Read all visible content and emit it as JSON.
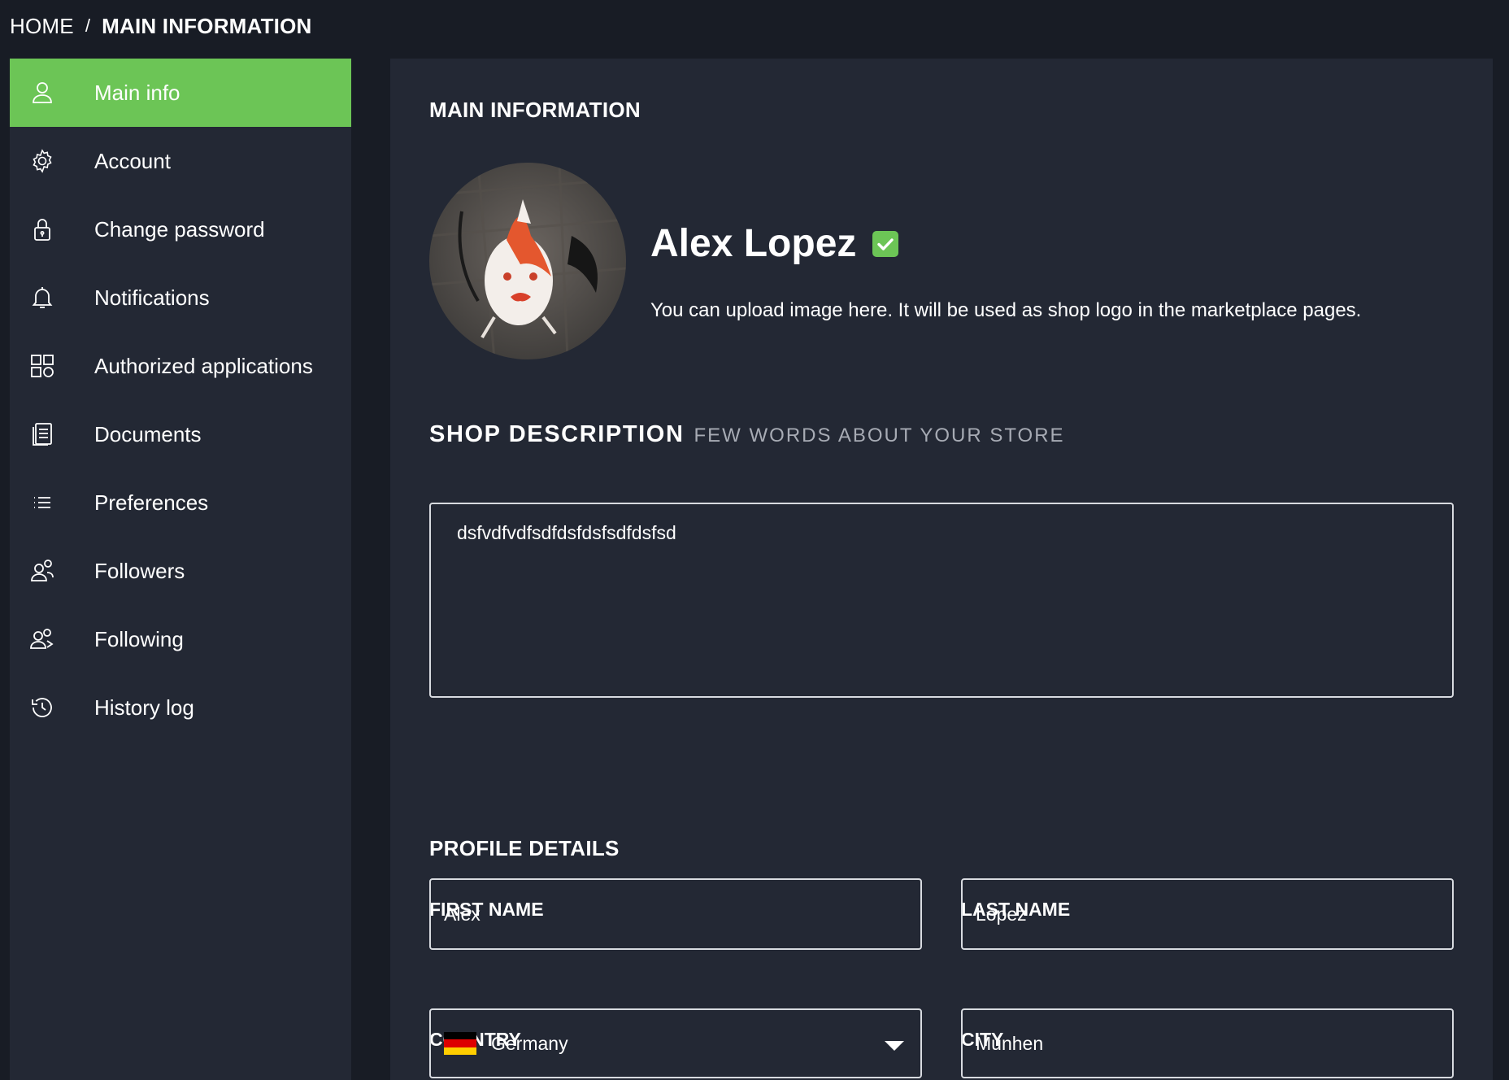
{
  "breadcrumb": {
    "home": "HOME",
    "separator": "/",
    "current": "MAIN INFORMATION"
  },
  "sidebar": {
    "items": [
      {
        "label": "Main info",
        "icon": "user-icon",
        "active": true
      },
      {
        "label": "Account",
        "icon": "gear-icon"
      },
      {
        "label": "Change password",
        "icon": "lock-icon"
      },
      {
        "label": "Notifications",
        "icon": "bell-icon"
      },
      {
        "label": "Authorized applications",
        "icon": "apps-grid-icon"
      },
      {
        "label": "Documents",
        "icon": "documents-icon"
      },
      {
        "label": "Preferences",
        "icon": "list-icon"
      },
      {
        "label": "Followers",
        "icon": "followers-icon"
      },
      {
        "label": "Following",
        "icon": "following-icon"
      },
      {
        "label": "History log",
        "icon": "history-icon"
      }
    ]
  },
  "main": {
    "title": "MAIN INFORMATION",
    "profile": {
      "name": "Alex Lopez",
      "verified": true,
      "upload_hint": "You can upload image here. It will be used as shop logo in the marketplace pages."
    },
    "shop_description": {
      "title": "SHOP DESCRIPTION",
      "subtitle": "FEW WORDS ABOUT YOUR STORE",
      "value": "dsfvdfvdfsdfdsfdsfsdfdsfsd"
    },
    "profile_details": {
      "title": "PROFILE DETAILS",
      "first_name_label": "FIRST NAME",
      "first_name_value": "Alex",
      "last_name_label": "LAST NAME",
      "last_name_value": "Lopez",
      "country_label": "COUNTRY",
      "country_value": "Germany",
      "city_label": "CITY",
      "city_value": "Munhen"
    }
  },
  "colors": {
    "background": "#181c25",
    "panel": "#232834",
    "accent_green": "#6cc556",
    "border": "#d8dbe0",
    "muted_text": "#a7abb4"
  }
}
